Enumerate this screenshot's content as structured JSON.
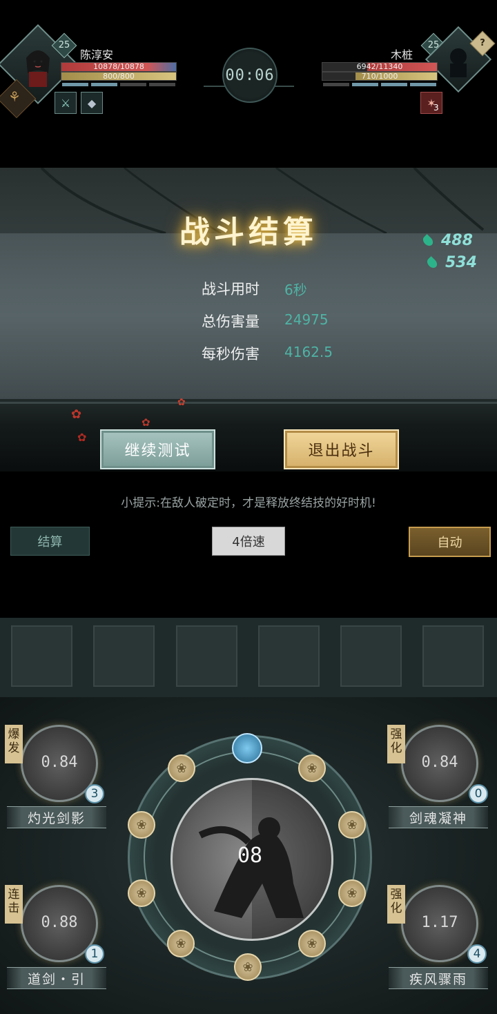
{
  "player": {
    "level": "25",
    "name": "陈淳安",
    "hp": "10878/10878",
    "mp": "800/800"
  },
  "timer": "00:06",
  "enemy": {
    "level": "25",
    "name": "木桩",
    "hp": "6942/11340",
    "mp": "710/1000",
    "unknown_badge": "?",
    "buff_count": "3"
  },
  "result": {
    "title": "战斗结算",
    "resources": [
      "488",
      "534"
    ],
    "stats": [
      {
        "label": "战斗用时",
        "value": "6秒"
      },
      {
        "label": "总伤害量",
        "value": "24975"
      },
      {
        "label": "每秒伤害",
        "value": "4162.5"
      }
    ],
    "continue_label": "继续测试",
    "exit_label": "退出战斗"
  },
  "tip": "小提示:在敌人破定时，才是释放终结技的好时机!",
  "controls": {
    "settle_label": "结算",
    "speed_label": "4倍速",
    "auto_label": "自动"
  },
  "center_skill": {
    "cooldown": "08"
  },
  "skills": [
    {
      "tag": "爆发",
      "name": "灼光剑影",
      "cooldown": "0.84",
      "count": "3"
    },
    {
      "tag": "强化",
      "name": "剑魂凝神",
      "cooldown": "0.84",
      "count": "0"
    },
    {
      "tag": "连击",
      "name": "道剑・引",
      "cooldown": "0.88",
      "count": "1"
    },
    {
      "tag": "强化",
      "name": "疾风骤雨",
      "cooldown": "1.17",
      "count": "4"
    }
  ],
  "colors": {
    "accent_teal": "#4fb3a5",
    "gold": "#d5b06a",
    "hp_red": "#c94a4a",
    "mp_yellow": "#d9c27a"
  }
}
